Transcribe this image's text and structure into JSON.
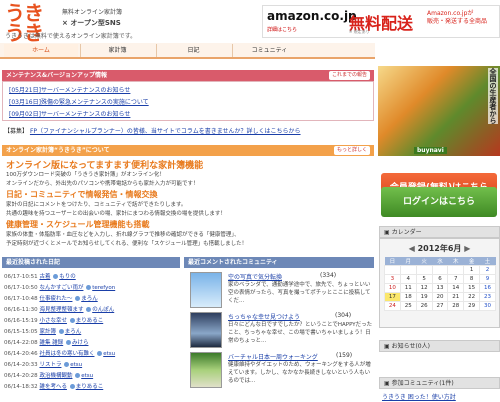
{
  "header": {
    "logo": "うきうき",
    "tagline1": "無料オンライン家計簿",
    "tagline2": "オープン型SNS",
    "tagline3": "うきうきは無料で使えるオンライン家計簿です。",
    "ad": {
      "logo": "amazon.co.jp",
      "logo_sub": "詳細はこちら",
      "headline": "無料配送",
      "sub": "※ 規定あり",
      "right1": "Amazon.co.jpが",
      "right2": "販売・発送する全商品"
    }
  },
  "nav": {
    "tabs": [
      {
        "label": "ホーム"
      },
      {
        "label": "家計簿"
      },
      {
        "label": "日記"
      },
      {
        "label": "コミュニティ"
      }
    ]
  },
  "maintenance": {
    "title": "メンテナンス&バージョンアップ情報",
    "more": "これまでの報告",
    "items": [
      "[05月21日]サーバーメンテナンスのお知らせ",
      "[03月16日]殊傷の緊急メンテナンスの実施について",
      "[09月02日]サーバーメンテナンスのお知らせ"
    ]
  },
  "notice": {
    "tag": "【募集】",
    "link": "FP（ファイナンシャルプランナー）の皆様、当サイトでコラムを書きませんか？詳しくはこちらから"
  },
  "news": {
    "title": "オンライン家計簿“うきうき”について",
    "more": "もっと詳しく",
    "h1": "オンライン版になってますます便利な家計簿機能",
    "t1": "100万ダウンロード突破の「うきうき家計簿」がオンライン化！",
    "t1b": "オンラインだから、外出先のパソコンや携帯電話からも家計入力が可能です！",
    "h2": "日記・コミュニティで情報発信・情報交換",
    "t2": "家計の日記にコメントをつけたり、コミュニティで話ができたりします。",
    "t2b": "共通の趣味を持つユーザーとの出会いの場、家計にまつわる情報交換の場を提供します！",
    "h3": "健康管理・スケジュール管理機能も搭載",
    "t3": "家族の体重・体脂肪率・血圧などを入力し、折れ線グラフで推移の確認ができる「健康管理」、",
    "t3b": "予定時刻が近づくとメールでお知らせしてくれる、便利な「スケジュール管理」も搭載しました！"
  },
  "diary": {
    "title": "最近投稿された日記",
    "rows": [
      {
        "date": "06/17-10:51",
        "title": "古着",
        "user": "もりの"
      },
      {
        "date": "06/17-10:50",
        "title": "なんかすごい雨が",
        "user": "terefyon"
      },
      {
        "date": "06/17-10:48",
        "title": "仕事疲れた～",
        "user": "まろん"
      },
      {
        "date": "06/16-11:30",
        "title": "海見整理整頓ます",
        "user": "のんぽん"
      },
      {
        "date": "06/16-15:19",
        "title": "小さな幸せ",
        "user": "まりあるこ"
      },
      {
        "date": "06/15-15:05",
        "title": "家計簿",
        "user": "まろん"
      },
      {
        "date": "06/14-22:08",
        "title": "雑集 雑録",
        "user": "みけら"
      },
      {
        "date": "06/14-20:46",
        "title": "社員は冬の寒い有難く",
        "user": "etsu"
      },
      {
        "date": "06/14-20:33",
        "title": "リストラ",
        "user": "etsu"
      },
      {
        "date": "06/14-20:28",
        "title": "政治機構観動",
        "user": "etsu"
      },
      {
        "date": "06/14-18:32",
        "title": "雑を考へる",
        "user": "まりあるこ"
      }
    ]
  },
  "comments": {
    "title": "最近コメントされたコミュニティ",
    "items": [
      {
        "title": "空の写真で気分転換",
        "count": "(334)",
        "text": "家のベランダで、通勤通学途中で、旅先で、ちょっといい空の表情がったら、写真を撮ってポチッとここに投稿してくだ..."
      },
      {
        "title": "ちっちゃな幸せ見つけよう",
        "count": "(304)",
        "text": "日々にどんな日ですでしたか？ということでHAPPYだったこと、ちっちゃな幸せ、この場で書いちゃいましょう！日常のちょっと..."
      },
      {
        "title": "バーチャル日本一周ウォーキング",
        "count": "(159)",
        "text": "健康維持やダイエットのため、ウォーキングをする人が増えています。しかし、なかなか長続きしないという人もいるのでは..."
      }
    ]
  },
  "sidebar": {
    "veg_title": "全国の生産者から",
    "veg_brand": "buynavi",
    "register": "会員登録(無料)はこちら",
    "login": "ログインはこちら",
    "calendar_label": "カレンダー",
    "calendar_title": "2012年6月",
    "weekdays": [
      "日",
      "月",
      "火",
      "水",
      "木",
      "金",
      "土"
    ],
    "weeks": [
      [
        "",
        "",
        "",
        "",
        "",
        "1",
        "2"
      ],
      [
        "3",
        "4",
        "5",
        "6",
        "7",
        "8",
        "9"
      ],
      [
        "10",
        "11",
        "12",
        "13",
        "14",
        "15",
        "16"
      ],
      [
        "17",
        "18",
        "19",
        "20",
        "21",
        "22",
        "23"
      ],
      [
        "24",
        "25",
        "26",
        "27",
        "28",
        "29",
        "30"
      ]
    ],
    "today": "17",
    "oshirase": "お知らせ(0人)",
    "community": "参加コミュニティ(1件)",
    "community_link": "うきうき 困った！使い方討"
  },
  "colors": {
    "accent": "#e8531f",
    "maint_bar": "#d95b6b",
    "news_bar": "#f3a14a",
    "section_bar": "#6d88b7",
    "register": "#e8501f",
    "login": "#5aa23a"
  }
}
